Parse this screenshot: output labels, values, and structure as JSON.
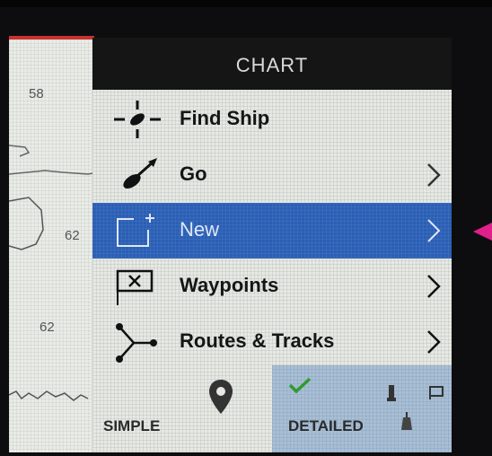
{
  "chart": {
    "depths": [
      "58",
      "62",
      "62"
    ]
  },
  "panel": {
    "title": "CHART",
    "items": [
      {
        "label": "Find Ship",
        "icon": "crosshair-ship-icon",
        "has_submenu": false,
        "selected": false
      },
      {
        "label": "Go",
        "icon": "go-arrow-icon",
        "has_submenu": true,
        "selected": false
      },
      {
        "label": "New",
        "icon": "new-item-icon",
        "has_submenu": true,
        "selected": true
      },
      {
        "label": "Waypoints",
        "icon": "waypoint-flag-icon",
        "has_submenu": true,
        "selected": false
      },
      {
        "label": "Routes & Tracks",
        "icon": "route-icon",
        "has_submenu": true,
        "selected": false
      }
    ],
    "views": {
      "simple_label": "SIMPLE",
      "detailed_label": "DETAILED",
      "active": "DETAILED"
    }
  },
  "colors": {
    "selected": "#2a5fb5",
    "header": "#151515",
    "indicator": "#e0208a",
    "check": "#2e9b2e"
  }
}
